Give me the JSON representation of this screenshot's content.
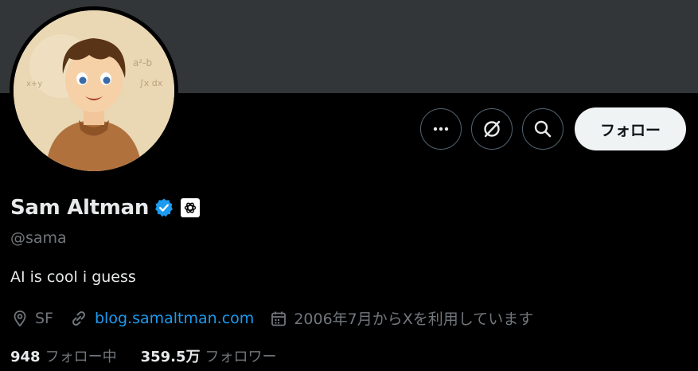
{
  "profile": {
    "display_name": "Sam Altman",
    "handle": "@sama",
    "bio": "AI is cool i guess",
    "location": "SF",
    "website": "blog.samaltman.com",
    "joined": "2006年7月からXを利用しています",
    "verified": true,
    "affiliate_badge": "openai-logo-icon"
  },
  "actions": {
    "more_icon": "more-icon",
    "grok_icon": "slash-circle-icon",
    "search_icon": "search-icon",
    "follow_label": "フォロー"
  },
  "stats": {
    "following_count": "948",
    "following_label": "フォロー中",
    "followers_count": "359.5万",
    "followers_label": "フォロワー"
  },
  "colors": {
    "background": "#000000",
    "banner": "#333639",
    "link": "#1d9bf0",
    "verified": "#1d9bf0",
    "secondary_text": "#71767b",
    "primary_text": "#e7e9ea",
    "follow_button": "#eff3f4"
  }
}
